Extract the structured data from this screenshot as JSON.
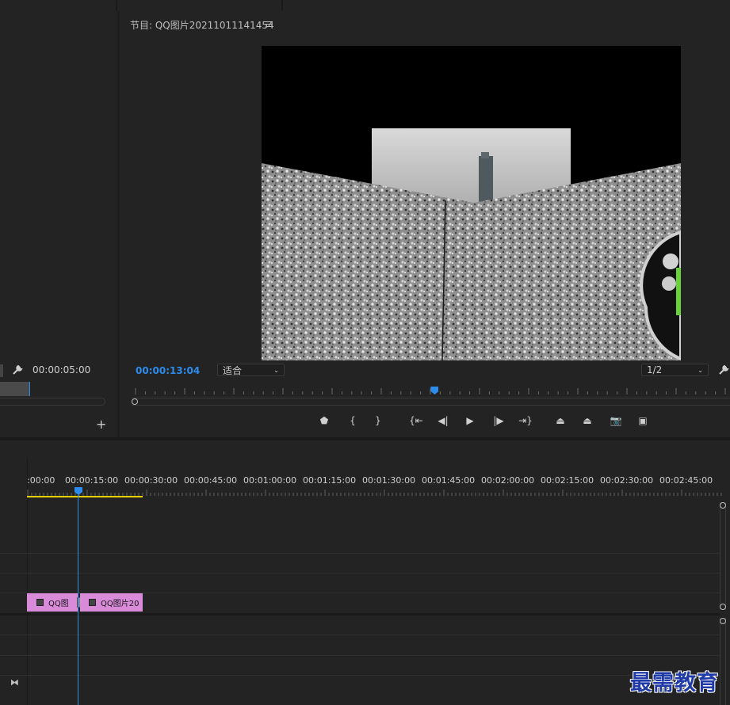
{
  "source_monitor": {
    "timecode": "00:00:05:00"
  },
  "program_monitor": {
    "title": "节目: QQ图片20211011141454",
    "menu_icon": "hamburger-icon",
    "timecode": "00:00:13:04",
    "zoom_select": "适合",
    "resolution_select": "1/2",
    "playhead_fraction": 0.51,
    "transport": [
      {
        "name": "add-marker-button",
        "glyph": "⬟"
      },
      {
        "name": "mark-in-button",
        "glyph": "{"
      },
      {
        "name": "mark-out-button",
        "glyph": "}"
      },
      {
        "name": "go-to-in-button",
        "glyph": "{⇤"
      },
      {
        "name": "step-back-button",
        "glyph": "◀|"
      },
      {
        "name": "play-button",
        "glyph": "▶"
      },
      {
        "name": "step-forward-button",
        "glyph": "|▶"
      },
      {
        "name": "go-to-out-button",
        "glyph": "⇥}"
      },
      {
        "name": "lift-button",
        "glyph": "⏏"
      },
      {
        "name": "extract-button",
        "glyph": "⏏"
      },
      {
        "name": "export-frame-button",
        "glyph": "📷"
      },
      {
        "name": "compare-view-button",
        "glyph": "▣"
      }
    ]
  },
  "timeline": {
    "ruler_labels": [
      ":00:00",
      "00:00:15:00",
      "00:00:30:00",
      "00:00:45:00",
      "00:01:00:00",
      "00:01:15:00",
      "00:01:30:00",
      "00:01:45:00",
      "00:02:00:00",
      "00:02:15:00",
      "00:02:30:00",
      "00:02:45:00"
    ],
    "clips": [
      {
        "label": "QQ图"
      },
      {
        "label": "QQ图片20"
      }
    ]
  },
  "watermark": "最需教育",
  "colors": {
    "accent_blue": "#2d8ceb",
    "clip_pink": "#d98ad9",
    "work_area_yellow": "#e8d000"
  }
}
